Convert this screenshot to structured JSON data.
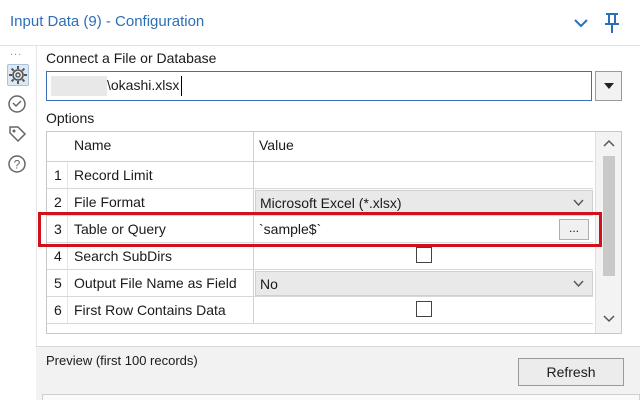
{
  "window": {
    "title": "Input Data (9) - Configuration",
    "collapse_icon": "chevron-down-icon",
    "pin_icon": "pin-icon"
  },
  "sidebar": {
    "more_label": "...",
    "icons": [
      "gear-icon",
      "connections-icon",
      "tag-icon",
      "help-icon"
    ]
  },
  "connect": {
    "label": "Connect a File or Database",
    "value": "\\okashi.xlsx"
  },
  "options": {
    "label": "Options",
    "columns": [
      "Name",
      "Value"
    ],
    "rows": [
      {
        "num": "1",
        "name": "Record Limit",
        "value": ""
      },
      {
        "num": "2",
        "name": "File Format",
        "value": "Microsoft Excel (*.xlsx)"
      },
      {
        "num": "3",
        "name": "Table or Query",
        "value": "`sample$`",
        "button": "..."
      },
      {
        "num": "4",
        "name": "Search SubDirs",
        "checked": false
      },
      {
        "num": "5",
        "name": "Output File Name as Field",
        "value": "No"
      },
      {
        "num": "6",
        "name": "First Row Contains Data",
        "checked": false
      }
    ]
  },
  "preview": {
    "label": "Preview (first 100 records)",
    "refresh_label": "Refresh"
  },
  "colors": {
    "accent": "#2d6fb7",
    "highlight": "#d0101a"
  }
}
